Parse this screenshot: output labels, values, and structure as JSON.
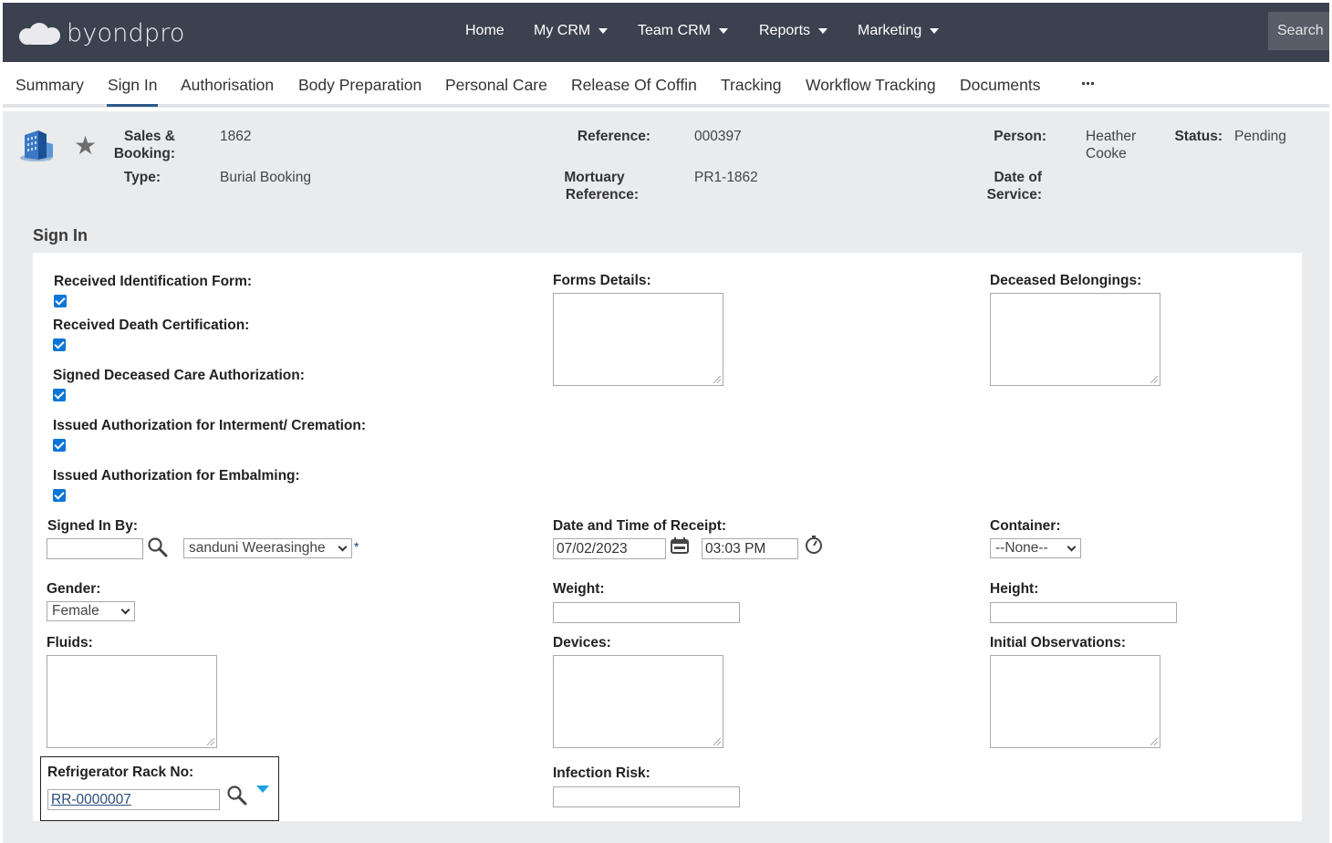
{
  "brand": {
    "name": "byondpro"
  },
  "nav": {
    "items": [
      {
        "label": "Home",
        "has_caret": false
      },
      {
        "label": "My CRM",
        "has_caret": true
      },
      {
        "label": "Team CRM",
        "has_caret": true
      },
      {
        "label": "Reports",
        "has_caret": true
      },
      {
        "label": "Marketing",
        "has_caret": true
      }
    ],
    "search_label": "Search"
  },
  "tabs": [
    {
      "label": "Summary",
      "active": false
    },
    {
      "label": "Sign In",
      "active": true
    },
    {
      "label": "Authorisation",
      "active": false
    },
    {
      "label": "Body Preparation",
      "active": false
    },
    {
      "label": "Personal Care",
      "active": false
    },
    {
      "label": "Release Of Coffin",
      "active": false
    },
    {
      "label": "Tracking",
      "active": false
    },
    {
      "label": "Workflow Tracking",
      "active": false
    },
    {
      "label": "Documents",
      "active": false
    }
  ],
  "record": {
    "icons": {
      "record_type": "building-icon",
      "favorite": "star-icon"
    },
    "sales_booking": {
      "label_line1": "Sales &",
      "label_line2": "Booking:",
      "value": "1862"
    },
    "type": {
      "label": "Type:",
      "value": "Burial Booking"
    },
    "reference": {
      "label": "Reference:",
      "value": "000397"
    },
    "mortuary_reference": {
      "label_line1": "Mortuary",
      "label_line2": "Reference:",
      "value": "PR1-1862"
    },
    "person": {
      "label": "Person:",
      "value_line1": "Heather",
      "value_line2": "Cooke"
    },
    "status": {
      "label": "Status:",
      "value": "Pending"
    },
    "date_of_service": {
      "label_line1": "Date of",
      "label_line2": "Service:",
      "value": ""
    }
  },
  "section": {
    "title": "Sign In"
  },
  "form": {
    "received_identification_form": {
      "label": "Received Identification Form:",
      "checked": true
    },
    "received_death_certification": {
      "label": "Received Death Certification:",
      "checked": true
    },
    "signed_deceased_care_authorization": {
      "label": "Signed Deceased Care Authorization:",
      "checked": true
    },
    "issued_authorization_interment": {
      "label": "Issued Authorization for Interment/ Cremation:",
      "checked": true
    },
    "issued_authorization_embalming": {
      "label": "Issued Authorization for Embalming:",
      "checked": true
    },
    "forms_details": {
      "label": "Forms Details:",
      "value": ""
    },
    "deceased_belongings": {
      "label": "Deceased Belongings:",
      "value": ""
    },
    "signed_in_by": {
      "label": "Signed In By:",
      "search_value": "",
      "selected": "sanduni Weerasinghe",
      "required_mark": "*"
    },
    "date_time_of_receipt": {
      "label": "Date and Time of Receipt:",
      "date": "07/02/2023",
      "time": "03:03 PM"
    },
    "container": {
      "label": "Container:",
      "selected": "--None--"
    },
    "gender": {
      "label": "Gender:",
      "selected": "Female"
    },
    "weight": {
      "label": "Weight:",
      "value": ""
    },
    "height": {
      "label": "Height:",
      "value": ""
    },
    "fluids": {
      "label": "Fluids:",
      "value": ""
    },
    "devices": {
      "label": "Devices:",
      "value": ""
    },
    "initial_observations": {
      "label": "Initial Observations:",
      "value": ""
    },
    "refrigerator_rack_no": {
      "label": "Refrigerator Rack No:",
      "value": "RR-0000007"
    },
    "infection_risk": {
      "label": "Infection Risk:",
      "value": ""
    }
  },
  "colors": {
    "topbar": "#3c4150",
    "accent": "#2c5a8c",
    "checkbox": "#0b75d8",
    "background": "#eaebed",
    "dropdown_triangle": "#1ba1e2"
  }
}
